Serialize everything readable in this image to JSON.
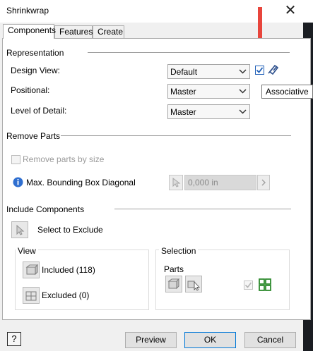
{
  "window": {
    "title": "Shrinkwrap"
  },
  "tabs": [
    {
      "label": "Components",
      "active": true
    },
    {
      "label": "Features",
      "active": false
    },
    {
      "label": "Create",
      "active": false
    }
  ],
  "representation": {
    "heading": "Representation",
    "design_view": {
      "label": "Design View:",
      "value": "Default",
      "associative_checked": true
    },
    "positional": {
      "label": "Positional:",
      "value": "Master"
    },
    "level_of_detail": {
      "label": "Level of Detail:",
      "value": "Master"
    }
  },
  "tooltip": "Associative",
  "remove_parts": {
    "heading": "Remove Parts",
    "checkbox_label": "Remove parts by size",
    "checked": false,
    "max_label": "Max. Bounding Box Diagonal",
    "max_value": "0,000 in"
  },
  "include": {
    "heading": "Include Components",
    "select_label": "Select to Exclude"
  },
  "view": {
    "heading": "View",
    "included_label": "Included (118)",
    "excluded_label": "Excluded (0)"
  },
  "selection": {
    "heading": "Selection",
    "parts_label": "Parts"
  },
  "footer": {
    "help": "?",
    "preview": "Preview",
    "ok": "OK",
    "cancel": "Cancel"
  },
  "colors": {
    "accent": "#e8453c",
    "link_blue": "#1f5fb8",
    "green": "#2e8b2e"
  }
}
